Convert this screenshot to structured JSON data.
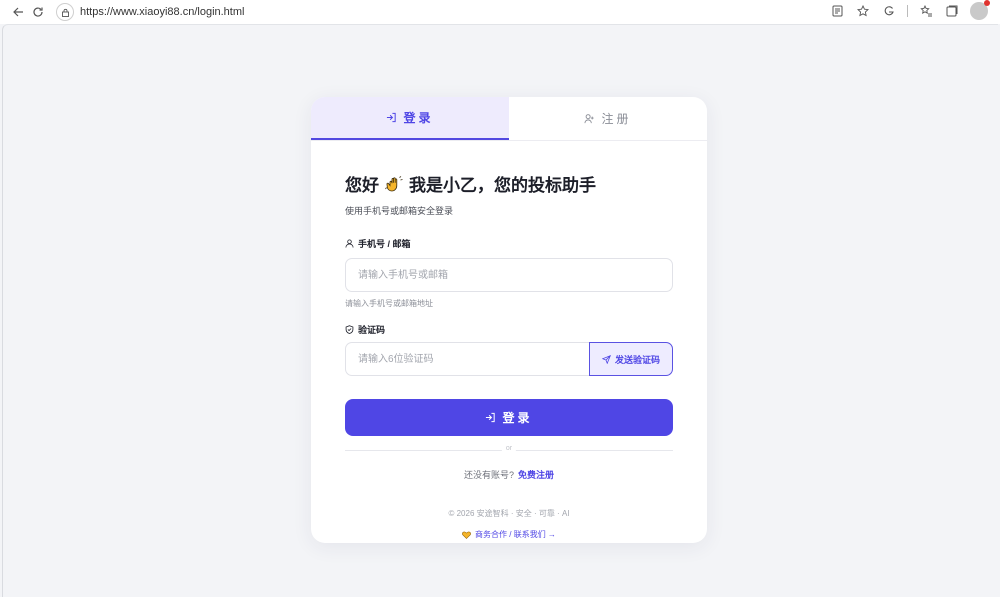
{
  "browser": {
    "url": "https://www.xiaoyi88.cn/login.html"
  },
  "tabs": {
    "login": "登录",
    "register": "注册"
  },
  "heading": {
    "prefix": "您好",
    "suffix": "我是小乙，您的投标助手"
  },
  "subtitle": "使用手机号或邮箱安全登录",
  "phone": {
    "label": "手机号 / 邮箱",
    "placeholder": "请输入手机号或邮箱",
    "hint": "请输入手机号或邮箱地址"
  },
  "code": {
    "label": "验证码",
    "placeholder": "请输入6位验证码",
    "send_label": "发送验证码"
  },
  "login_button": "登录",
  "divider": "or",
  "register_prompt": {
    "text": "还没有账号?",
    "link": "免费注册"
  },
  "footer": {
    "copyright": "© 2026 安途智科 · 安全 · 可靠 · AI",
    "business": "商务合作 / 联系我们 →"
  },
  "colors": {
    "accent": "#4f46e5",
    "tab_active_bg": "#eeebfd"
  }
}
